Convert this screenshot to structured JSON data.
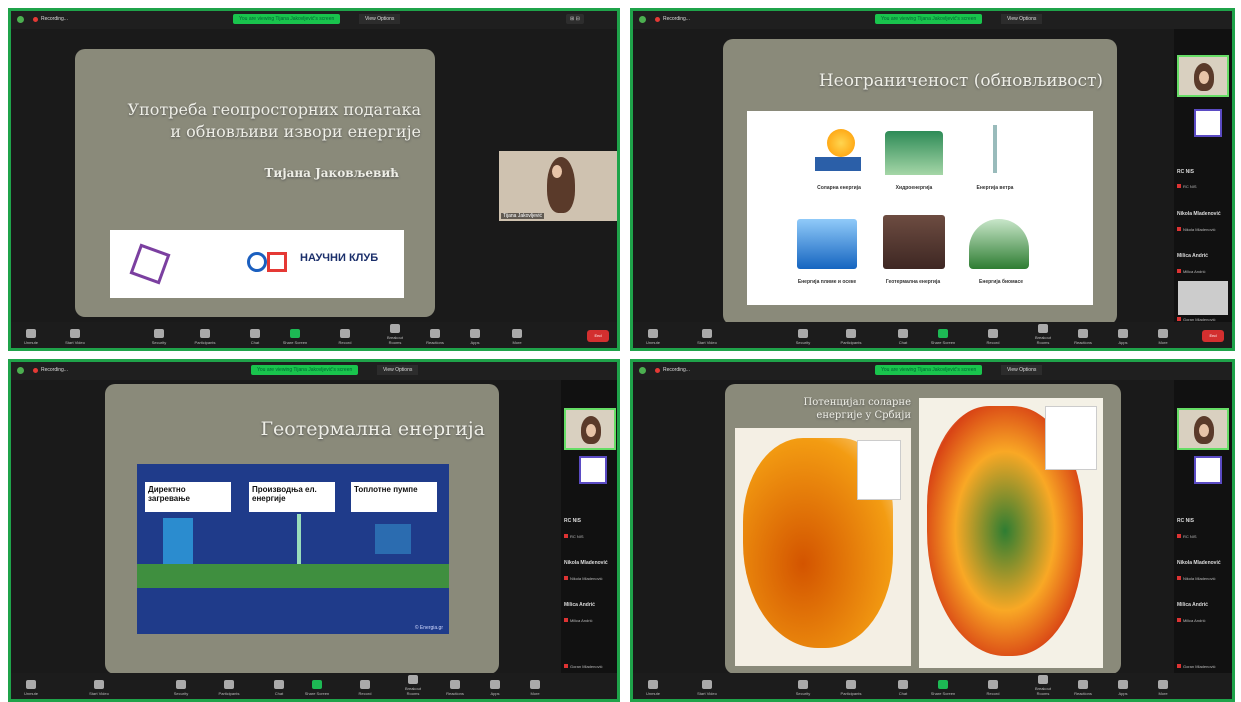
{
  "window": {
    "recording_label": "Recording...",
    "banner_text": "You are viewing Tijana Jakovljević's screen",
    "view_options": "View Options"
  },
  "toolbar": {
    "items": [
      "Unmute",
      "Start Video",
      "Security",
      "Participants",
      "Chat",
      "Share Screen",
      "Record",
      "Breakout Rooms",
      "Reactions",
      "Apps",
      "More"
    ],
    "end": "End",
    "participants_count": "12"
  },
  "panel1": {
    "title_line1": "Употреба геопросторних података",
    "title_line2": "и обновљиви извори енергије",
    "author": "Тијана Јаковљевић",
    "logo_right": "НАУЧНИ КЛУБ",
    "presenter_label": "Tijana Jakovljević"
  },
  "panel2": {
    "title": "Неограниченост (обновљивост)",
    "icons": [
      {
        "label": "Соларна енергија"
      },
      {
        "label": "Хидроенергија"
      },
      {
        "label": "Енергија ветра"
      },
      {
        "label": "Енергија плиме и осеке"
      },
      {
        "label": "Геотермална енергија"
      },
      {
        "label": "Енергија биомасе"
      }
    ]
  },
  "panel3": {
    "title": "Геотермална енергија",
    "cards": [
      "Директно загревање",
      "Производња ел. енергије",
      "Топлотне пумпе"
    ],
    "credit": "© Energia.gr"
  },
  "panel4": {
    "title_line1": "Потенцијал соларне",
    "title_line2": "енергије у Србији"
  },
  "sidebar": {
    "p1": "RC NIS",
    "p1_tag": "RC NIS",
    "p2": "Nikola Mladenović",
    "p2_tag": "Nikola Mladenović",
    "p3": "Milica Andrić",
    "p3_tag": "Milica Andrić",
    "p4_tag": "Goran Mladenović"
  },
  "colors": {
    "frame": "#1fa34a",
    "slide_bg": "#8a8a7a",
    "banner": "#19c44d"
  }
}
